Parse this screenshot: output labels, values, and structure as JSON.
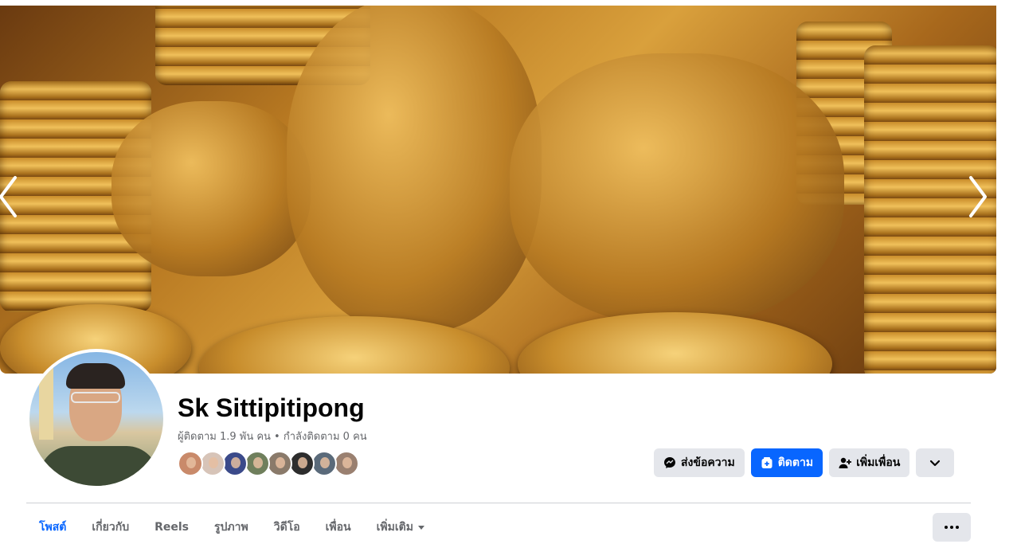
{
  "profile": {
    "name": "Sk Sittipitipong",
    "stats": "ผู้ติดตาม 1.9 พัน คน • กำลังติดตาม 0 คน",
    "friends_preview_colors": [
      "#c98a6a",
      "#d7c4b8",
      "#3b4a8a",
      "#6f7f5c",
      "#8a7a6a",
      "#2d2d2d",
      "#5a6a7a",
      "#9a8070"
    ]
  },
  "cover": {
    "prev_icon": "chevron-left-icon",
    "next_icon": "chevron-right-icon"
  },
  "actions": {
    "message_label": "ส่งข้อความ",
    "follow_label": "ติดตาม",
    "add_friend_label": "เพิ่มเพื่อน",
    "message_icon": "messenger-icon",
    "follow_icon": "follow-icon",
    "add_friend_icon": "add-friend-icon",
    "dropdown_icon": "chevron-down-icon"
  },
  "tabs": [
    {
      "label": "โพสต์",
      "active": true
    },
    {
      "label": "เกี่ยวกับ",
      "active": false
    },
    {
      "label": "Reels",
      "active": false
    },
    {
      "label": "รูปภาพ",
      "active": false
    },
    {
      "label": "วิดีโอ",
      "active": false
    },
    {
      "label": "เพื่อน",
      "active": false
    },
    {
      "label": "เพิ่มเติม",
      "active": false
    }
  ],
  "colors": {
    "accent": "#0866ff",
    "button_gray": "#e4e6eb",
    "secondary_text": "#65676b"
  }
}
